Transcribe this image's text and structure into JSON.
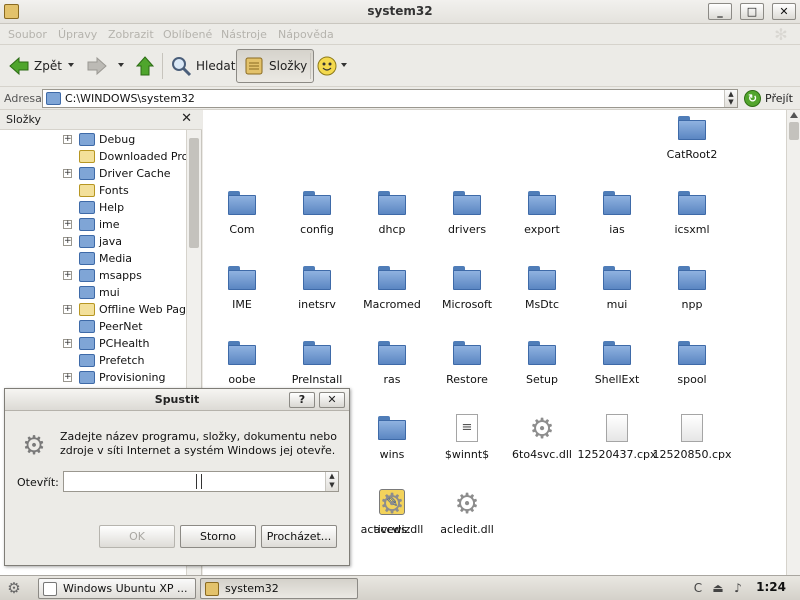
{
  "window": {
    "title": "system32"
  },
  "menubar": [
    "Soubor",
    "Úpravy",
    "Zobrazit",
    "Oblíbené",
    "Nástroje",
    "Nápověda"
  ],
  "toolbar": {
    "back_label": "Zpět",
    "search_label": "Hledat",
    "folders_label": "Složky"
  },
  "address": {
    "label": "Adresa",
    "value": "C:\\WINDOWS\\system32",
    "go_label": "Přejít"
  },
  "folder_pane": {
    "title": "Složky",
    "items": [
      {
        "label": "Debug",
        "expandable": true,
        "special": false
      },
      {
        "label": "Downloaded Program Files",
        "expandable": false,
        "special": true
      },
      {
        "label": "Driver Cache",
        "expandable": true,
        "special": false
      },
      {
        "label": "Fonts",
        "expandable": false,
        "special": true
      },
      {
        "label": "Help",
        "expandable": false,
        "special": false
      },
      {
        "label": "ime",
        "expandable": true,
        "special": false
      },
      {
        "label": "java",
        "expandable": true,
        "special": false
      },
      {
        "label": "Media",
        "expandable": false,
        "special": false
      },
      {
        "label": "msapps",
        "expandable": true,
        "special": false
      },
      {
        "label": "mui",
        "expandable": false,
        "special": false
      },
      {
        "label": "Offline Web Pages",
        "expandable": true,
        "special": true
      },
      {
        "label": "PeerNet",
        "expandable": false,
        "special": false
      },
      {
        "label": "PCHealth",
        "expandable": true,
        "special": false
      },
      {
        "label": "Prefetch",
        "expandable": false,
        "special": false
      },
      {
        "label": "Provisioning",
        "expandable": true,
        "special": false
      }
    ]
  },
  "files": [
    {
      "label": "CatRoot2",
      "kind": "folder"
    },
    {
      "label": "Com",
      "kind": "folder"
    },
    {
      "label": "config",
      "kind": "folder"
    },
    {
      "label": "dhcp",
      "kind": "folder"
    },
    {
      "label": "drivers",
      "kind": "folder"
    },
    {
      "label": "export",
      "kind": "folder"
    },
    {
      "label": "ias",
      "kind": "folder"
    },
    {
      "label": "icsxml",
      "kind": "folder"
    },
    {
      "label": "IME",
      "kind": "folder"
    },
    {
      "label": "inetsrv",
      "kind": "folder"
    },
    {
      "label": "Macromed",
      "kind": "folder"
    },
    {
      "label": "Microsoft",
      "kind": "folder"
    },
    {
      "label": "MsDtc",
      "kind": "folder"
    },
    {
      "label": "mui",
      "kind": "folder"
    },
    {
      "label": "npp",
      "kind": "folder"
    },
    {
      "label": "oobe",
      "kind": "folder"
    },
    {
      "label": "PreInstall",
      "kind": "folder"
    },
    {
      "label": "ras",
      "kind": "folder"
    },
    {
      "label": "Restore",
      "kind": "folder"
    },
    {
      "label": "Setup",
      "kind": "folder"
    },
    {
      "label": "ShellExt",
      "kind": "folder"
    },
    {
      "label": "spool",
      "kind": "folder"
    },
    {
      "label": "wins",
      "kind": "folder"
    },
    {
      "label": "$winnt$",
      "kind": "doc"
    },
    {
      "label": "6to4svc.dll",
      "kind": "gear"
    },
    {
      "label": "12520437.cpx",
      "kind": "file"
    },
    {
      "label": "12520850.cpx",
      "kind": "file"
    },
    {
      "label": "accwiz",
      "kind": "wizard"
    },
    {
      "label": "acledit.dll",
      "kind": "gear"
    },
    {
      "label": "aclui.dll",
      "kind": "gear"
    },
    {
      "label": "activeds",
      "kind": "file"
    },
    {
      "label": "activeds.dll",
      "kind": "gear"
    }
  ],
  "run_dialog": {
    "title": "Spustit",
    "help_label": "?",
    "close_label": "✕",
    "message": "Zadejte název programu, složky, dokumentu nebo zdroje v síti Internet a systém Windows jej otevře.",
    "open_label": "Otevřít:",
    "open_value": "",
    "ok_label": "OK",
    "cancel_label": "Storno",
    "browse_label": "Procházet..."
  },
  "taskbar": {
    "tasks": [
      {
        "label": "Windows Ubuntu XP ...",
        "active": false
      },
      {
        "label": "system32",
        "active": true
      }
    ],
    "clock": "1:24"
  }
}
